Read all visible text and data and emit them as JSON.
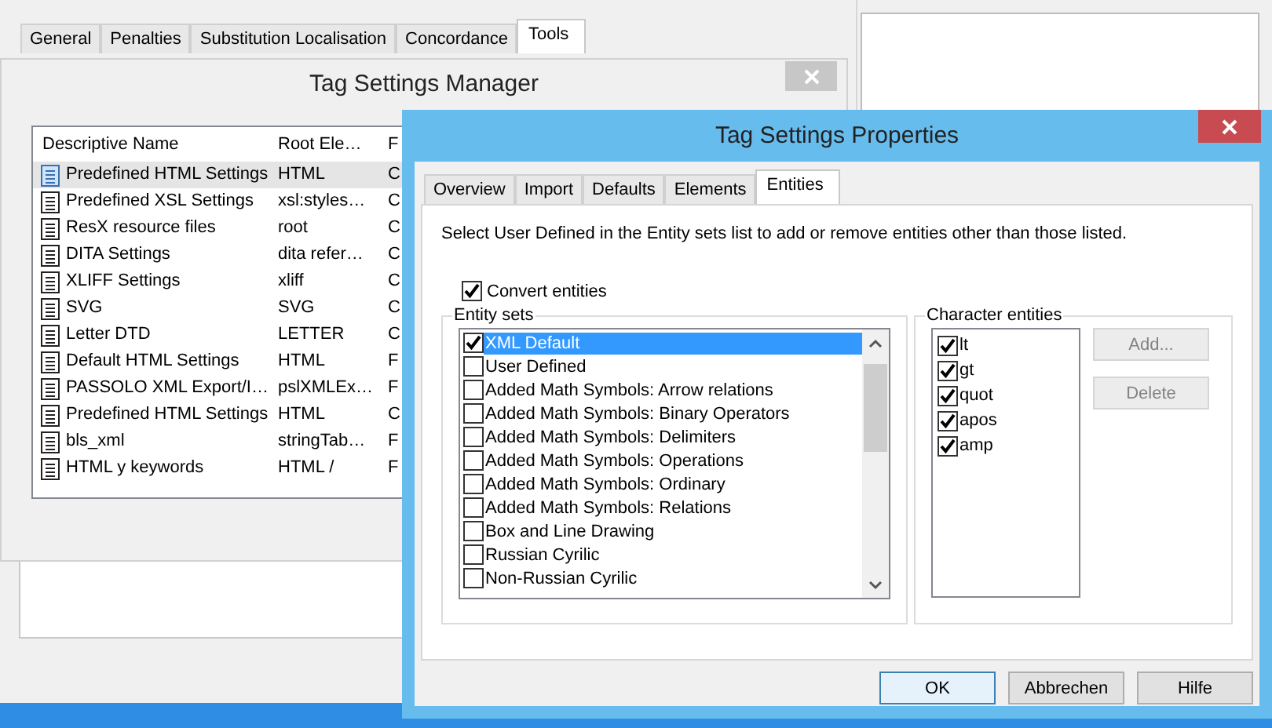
{
  "options_window": {
    "tabs": [
      {
        "label": "General",
        "selected": false
      },
      {
        "label": "Penalties",
        "selected": false
      },
      {
        "label": "Substitution Localisation",
        "selected": false
      },
      {
        "label": "Concordance",
        "selected": false
      },
      {
        "label": "Tools",
        "selected": true
      }
    ]
  },
  "manager_window": {
    "title": "Tag Settings Manager",
    "columns": [
      "Descriptive Name",
      "Root Ele…",
      "F"
    ],
    "rows": [
      {
        "cells": [
          "Predefined HTML Settings",
          "HTML",
          "C"
        ],
        "selected": true
      },
      {
        "cells": [
          "Predefined XSL Settings",
          "xsl:styles…",
          "C"
        ],
        "selected": false
      },
      {
        "cells": [
          "ResX resource files",
          "root",
          "C"
        ],
        "selected": false
      },
      {
        "cells": [
          "DITA Settings",
          "dita refer…",
          "C"
        ],
        "selected": false
      },
      {
        "cells": [
          "XLIFF Settings",
          "xliff",
          "C"
        ],
        "selected": false
      },
      {
        "cells": [
          "SVG",
          "SVG",
          "C"
        ],
        "selected": false
      },
      {
        "cells": [
          "Letter DTD",
          "LETTER",
          "C"
        ],
        "selected": false
      },
      {
        "cells": [
          "Default HTML Settings",
          "HTML",
          "F"
        ],
        "selected": false
      },
      {
        "cells": [
          "PASSOLO XML Export/I…",
          "pslXMLEx…",
          "F"
        ],
        "selected": false
      },
      {
        "cells": [
          "Predefined HTML Settings",
          "HTML",
          "C"
        ],
        "selected": false
      },
      {
        "cells": [
          "bls_xml",
          "stringTab…",
          "F"
        ],
        "selected": false
      },
      {
        "cells": [
          "HTML y keywords",
          "HTML /",
          "F"
        ],
        "selected": false
      }
    ]
  },
  "properties_window": {
    "title": "Tag Settings Properties",
    "tabs": [
      {
        "label": "Overview",
        "selected": false
      },
      {
        "label": "Import",
        "selected": false
      },
      {
        "label": "Defaults",
        "selected": false
      },
      {
        "label": "Elements",
        "selected": false
      },
      {
        "label": "Entities",
        "selected": true
      }
    ],
    "description": "Select User Defined in the Entity sets list to add or remove entities other than those listed.",
    "convert_entities": {
      "label": "Convert entities",
      "checked": true
    },
    "entity_sets": {
      "title": "Entity sets",
      "items": [
        {
          "label": "XML Default",
          "checked": true,
          "selected": true
        },
        {
          "label": "User Defined",
          "checked": false,
          "selected": false
        },
        {
          "label": "Added Math Symbols: Arrow relations",
          "checked": false,
          "selected": false
        },
        {
          "label": "Added Math Symbols: Binary Operators",
          "checked": false,
          "selected": false
        },
        {
          "label": "Added Math Symbols: Delimiters",
          "checked": false,
          "selected": false
        },
        {
          "label": "Added Math Symbols: Operations",
          "checked": false,
          "selected": false
        },
        {
          "label": "Added Math Symbols: Ordinary",
          "checked": false,
          "selected": false
        },
        {
          "label": "Added Math Symbols: Relations",
          "checked": false,
          "selected": false
        },
        {
          "label": "Box and Line Drawing",
          "checked": false,
          "selected": false
        },
        {
          "label": "Russian Cyrilic",
          "checked": false,
          "selected": false
        },
        {
          "label": "Non-Russian Cyrilic",
          "checked": false,
          "selected": false
        }
      ]
    },
    "character_entities": {
      "title": "Character entities",
      "items": [
        {
          "label": "lt",
          "checked": true
        },
        {
          "label": "gt",
          "checked": true
        },
        {
          "label": "quot",
          "checked": true
        },
        {
          "label": "apos",
          "checked": true
        },
        {
          "label": "amp",
          "checked": true
        }
      ]
    },
    "side_buttons": [
      {
        "label": "Add...",
        "disabled": true
      },
      {
        "label": "Delete",
        "disabled": true
      }
    ],
    "buttons": [
      {
        "label": "OK",
        "focused": true
      },
      {
        "label": "Abbrechen",
        "focused": false
      },
      {
        "label": "Hilfe",
        "focused": false
      }
    ]
  }
}
